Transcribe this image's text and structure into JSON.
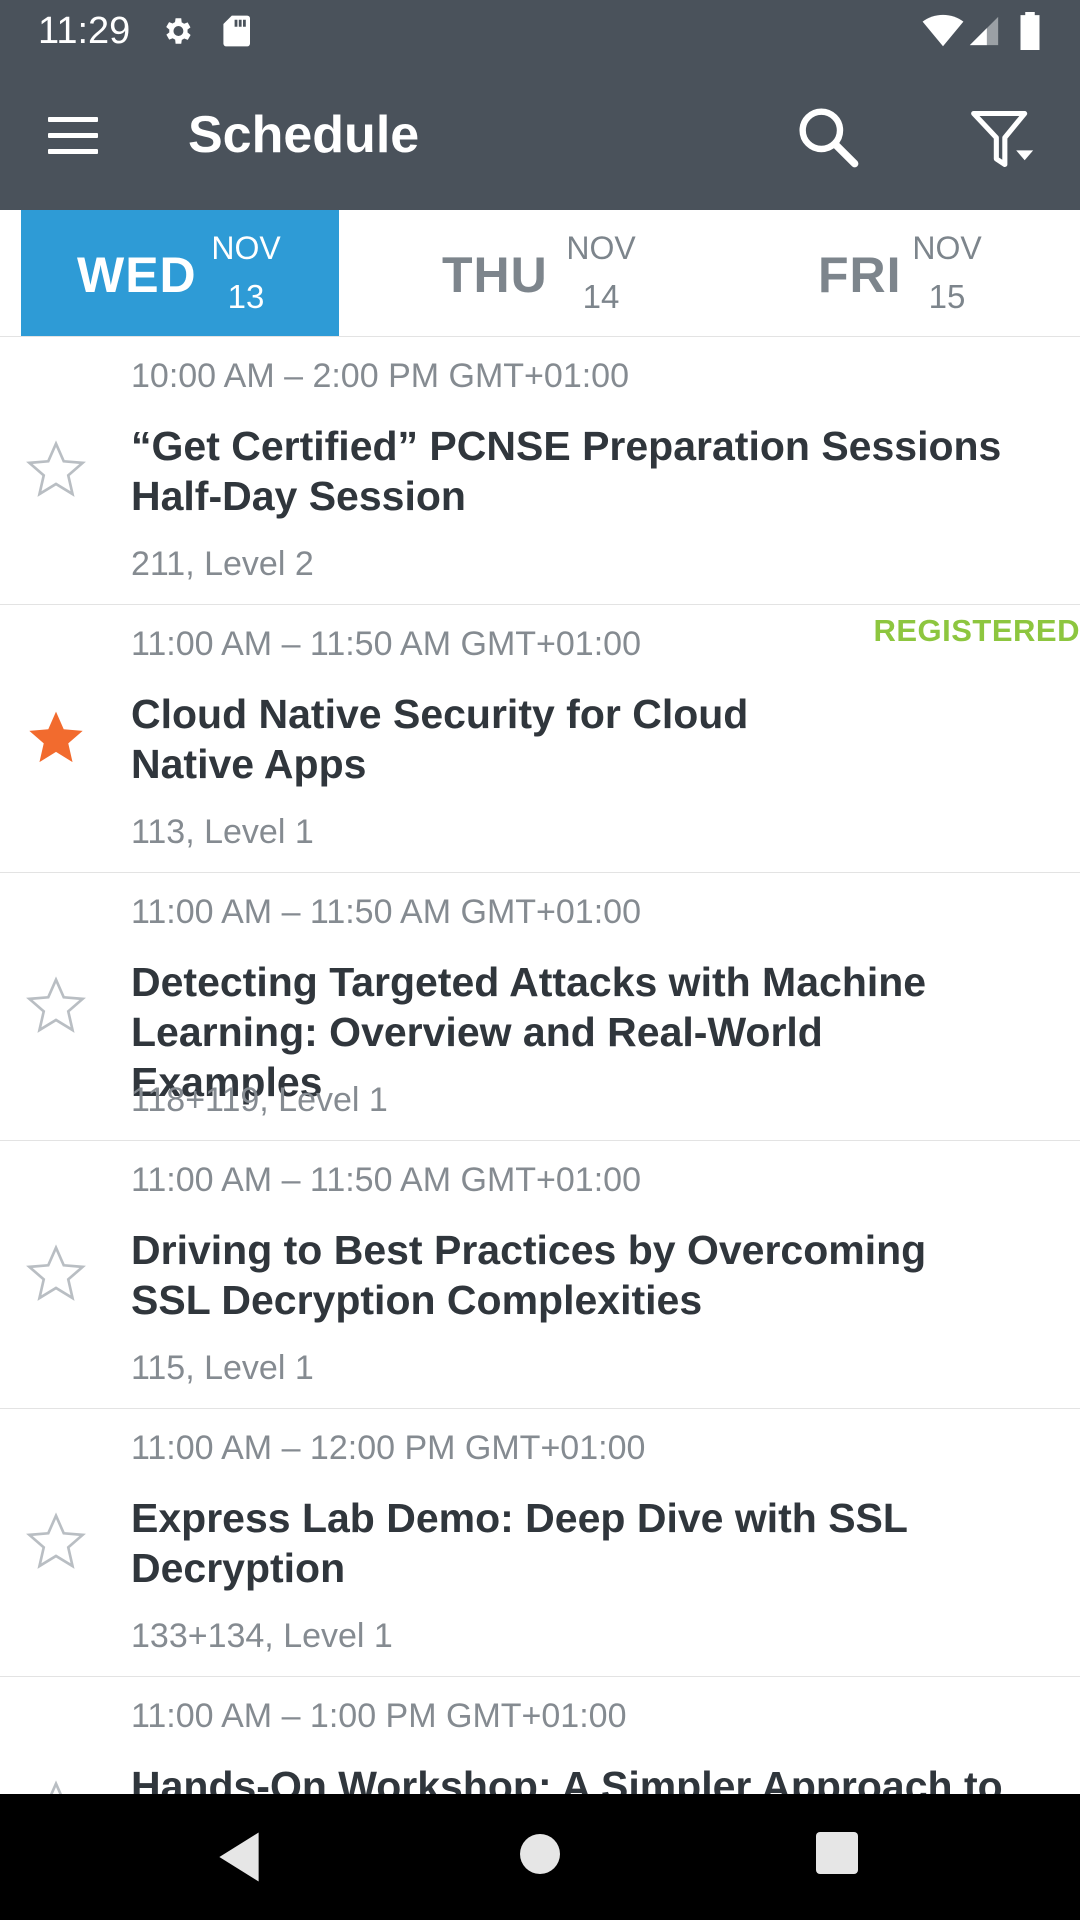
{
  "status_bar": {
    "time": "11:29",
    "icons": [
      "gear-icon",
      "sd-card-icon",
      "wifi-icon",
      "cell-signal-icon",
      "battery-icon"
    ]
  },
  "app_bar": {
    "title": "Schedule",
    "menu_icon": "hamburger-menu-icon",
    "search_icon": "search-icon",
    "filter_icon": "filter-icon",
    "background": "#4a525b"
  },
  "day_tabs": [
    {
      "dow": "WED",
      "month": "NOV",
      "day": "13",
      "selected": true
    },
    {
      "dow": "THU",
      "month": "NOV",
      "day": "14",
      "selected": false
    },
    {
      "dow": "FRI",
      "month": "NOV",
      "day": "15",
      "selected": false
    }
  ],
  "accent_color": "#2e9bd6",
  "registered_color": "#8dc63f",
  "star_active_color": "#f26b2e",
  "sessions": [
    {
      "time": "10:00 AM – 2:00 PM GMT+01:00",
      "title": "“Get Certified” PCNSE Preparation Sessions Half-Day Session",
      "location": "211, Level 2",
      "starred": false,
      "badge": ""
    },
    {
      "time": "11:00 AM – 11:50 AM GMT+01:00",
      "title": "Cloud Native Security for Cloud Native Apps",
      "location": "113, Level 1",
      "starred": true,
      "badge": "REGISTERED"
    },
    {
      "time": "11:00 AM – 11:50 AM GMT+01:00",
      "title": "Detecting Targeted Attacks with Machine Learning: Overview and Real-World Examples",
      "location": "118+119, Level 1",
      "starred": false,
      "badge": ""
    },
    {
      "time": "11:00 AM – 11:50 AM GMT+01:00",
      "title": "Driving to Best Practices by Overcoming SSL Decryption Complexities",
      "location": "115, Level 1",
      "starred": false,
      "badge": ""
    },
    {
      "time": "11:00 AM – 12:00 PM GMT+01:00",
      "title": "Express Lab Demo: Deep Dive with SSL Decryption",
      "location": "133+134, Level 1",
      "starred": false,
      "badge": ""
    },
    {
      "time": "11:00 AM – 1:00 PM GMT+01:00",
      "title": "Hands-On Workshop: A Simpler Approach to",
      "location": "",
      "starred": false,
      "badge": ""
    }
  ],
  "nav_bar": {
    "back_icon": "back-triangle-icon",
    "home_icon": "home-circle-icon",
    "recents_icon": "recents-square-icon"
  }
}
